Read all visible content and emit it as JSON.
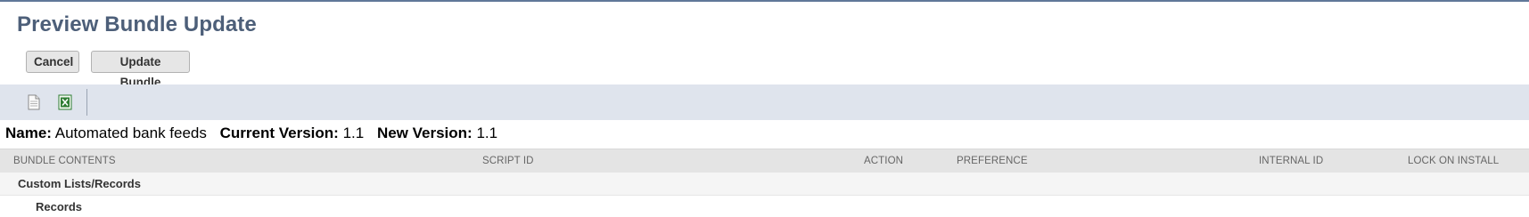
{
  "page": {
    "title": "Preview Bundle Update"
  },
  "buttons": {
    "cancel": "Cancel",
    "update": "Update Bundle"
  },
  "toolbar": {
    "icons": [
      "document-icon",
      "excel-export-icon"
    ]
  },
  "info": {
    "name_label": "Name:",
    "name_value": "Automated bank feeds",
    "current_label": "Current Version:",
    "current_value": "1.1",
    "new_label": "New Version:",
    "new_value": "1.1"
  },
  "table": {
    "columns": [
      "BUNDLE CONTENTS",
      "SCRIPT ID",
      "ACTION",
      "PREFERENCE",
      "INTERNAL ID",
      "LOCK ON INSTALL"
    ],
    "group": "Custom Lists/Records",
    "subgroup": "Records"
  },
  "colors": {
    "title": "#4d5f79",
    "toolbar_bg": "#dfe4ed",
    "header_bg": "#e4e4e4",
    "button_bg": "#e6e6e6"
  }
}
